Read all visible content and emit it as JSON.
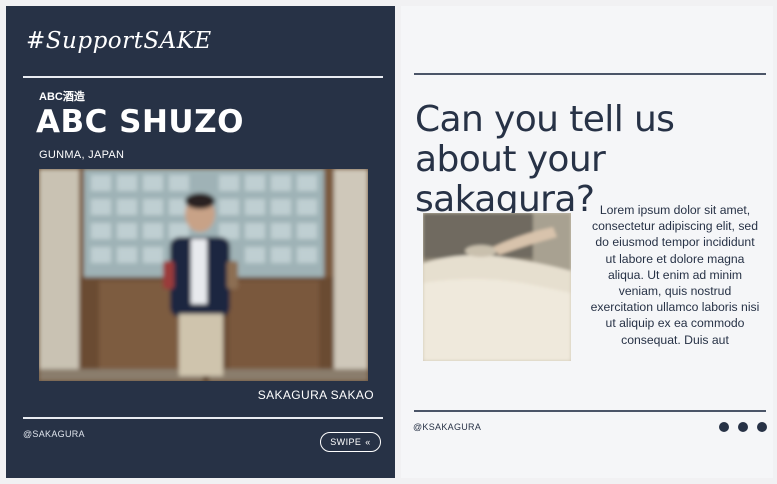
{
  "left_card": {
    "hashtag": "#SupportSAKE",
    "brewery_jp": "ABC酒造",
    "brewery_name": "ABC SHUZO",
    "location": "GUNMA, JAPAN",
    "photo_caption": "SAKAGURA SAKAO",
    "handle": "@SAKAGURA",
    "swipe_label": "SWIPE",
    "swipe_icon": "«"
  },
  "right_card": {
    "question": "Can you tell us about your sakagura?",
    "body_text": "Lorem ipsum dolor sit amet, consectetur adipiscing elit, sed do eiusmod tempor incididunt ut labore et dolore magna aliqua. Ut enim ad minim veniam, quis nostrud exercitation ullamco laboris nisi ut aliquip ex ea commodo consequat. Duis aut",
    "handle": "@KSAKAGURA"
  },
  "colors": {
    "navy": "#273246",
    "light_bg": "#f5f6f8",
    "white": "#ffffff"
  }
}
